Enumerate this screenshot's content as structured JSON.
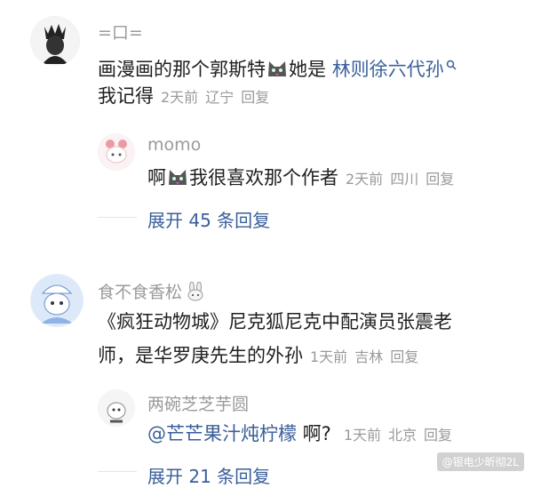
{
  "comments": [
    {
      "username": "=口=",
      "text_before": "画漫画的那个郭斯特",
      "text_mid": "她是 ",
      "link": "林则徐六代孙",
      "text_line2": "我记得",
      "time": "2天前",
      "location": "辽宁",
      "reply": "回复",
      "sub_reply": {
        "username": "momo",
        "text_before": "啊",
        "text_after": "我很喜欢那个作者",
        "time": "2天前",
        "location": "四川",
        "reply": "回复"
      },
      "expand_label": "展开 45 条回复"
    },
    {
      "username": "食不食香松",
      "text_line1": "《疯狂动物城》尼克狐尼克中配演员张震老",
      "text_line2": "师，是华罗庚先生的外孙",
      "time": "1天前",
      "location": "吉林",
      "reply": "回复",
      "sub_reply": {
        "username": "两碗芝芝芋圆",
        "mention": "@芒芒果汁炖柠檬",
        "text_after": " 啊?",
        "time": "1天前",
        "location": "北京",
        "reply": "回复"
      },
      "expand_label": "展开 21 条回复"
    }
  ],
  "watermark": "@银电少昕彻2L",
  "icons": [
    "search-icon",
    "cat-emoji-icon",
    "bunny-icon"
  ]
}
